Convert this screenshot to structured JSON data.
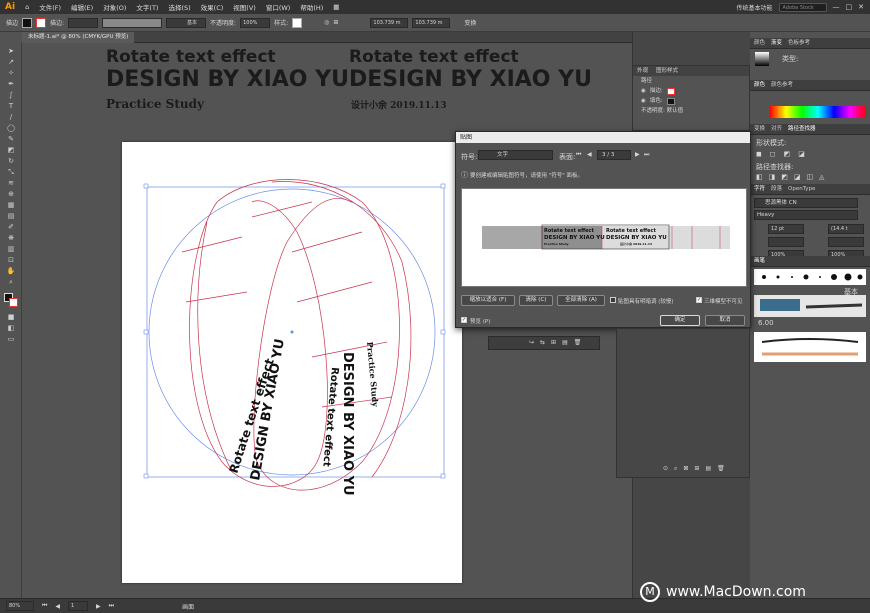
{
  "app": {
    "logo": "Ai",
    "menus": [
      "文件(F)",
      "编辑(E)",
      "对象(O)",
      "文字(T)",
      "选择(S)",
      "效果(C)",
      "视图(V)",
      "窗口(W)",
      "帮助(H)"
    ],
    "workspace": "传统基本功能",
    "search_placeholder": "Adobe Stock"
  },
  "control": {
    "label_left": "描边",
    "stroke_label": "描边:",
    "style_label": "基本",
    "opacity_label": "不透明度:",
    "opacity_value": "100%",
    "style2": "样式:",
    "x_value": "103.739 m",
    "y_value": "103.739 m",
    "transform": "变换"
  },
  "document": {
    "tab_title": "未标题-1.ai* @ 80% (CMYK/GPU 预览)"
  },
  "artboard": {
    "left": {
      "line1": "Rotate text effect",
      "line2": "DESIGN BY XIAO YU",
      "line3": "Practice  Study"
    },
    "right": {
      "line1": "Rotate text effect",
      "line2": "DESIGN BY XIAO YU",
      "line3": "设计小余   2019.11.13"
    }
  },
  "appearance": {
    "tabs": [
      "外观",
      "图形样式"
    ],
    "rows": [
      "路径",
      "描边:",
      "填色:",
      "不透明度: 默认值"
    ]
  },
  "dialog": {
    "title": "贴图",
    "symbol_label": "符号:",
    "symbol_value": "文字",
    "surface_label": "表面:",
    "surface_value": "3 / 3",
    "info": "要创建或编辑贴图符号，请使用 \"符号\" 面板。",
    "buttons": {
      "fit": "缩放以适合 (F)",
      "clear": "清除 (C)",
      "clear_all": "全部清除 (A)",
      "ok": "确定",
      "cancel": "取消"
    },
    "checkboxes": {
      "shade": "贴图具有明暗调 (较慢)",
      "invisible": "三维模型不可见",
      "preview": "预览 (P)"
    }
  },
  "right_panels": {
    "top_tabs": [
      "颜色",
      "渐变",
      "色板参考"
    ],
    "type_label": "类型:",
    "color_tabs": [
      "颜色",
      "颜色参考"
    ],
    "pathfinder_tabs": [
      "变换",
      "对齐",
      "路径查找器"
    ],
    "shape_mode": "形状模式:",
    "pathfinder_label": "路径查找器:",
    "char_tabs": [
      "字符",
      "段落",
      "OpenType"
    ],
    "font_family": "思源黑体 CN",
    "font_style": "Heavy",
    "font_size": "12 pt",
    "leading": "(14.4 t",
    "tracking": "100%",
    "scale": "100%",
    "brush_tabs": [
      "画笔"
    ],
    "brush_basic": "基本",
    "brush_size": "6.00"
  },
  "status": {
    "zoom": "80%",
    "page": "1",
    "mode": "画面"
  },
  "watermark": {
    "symbol": "M",
    "text": "www.MacDown.com"
  }
}
